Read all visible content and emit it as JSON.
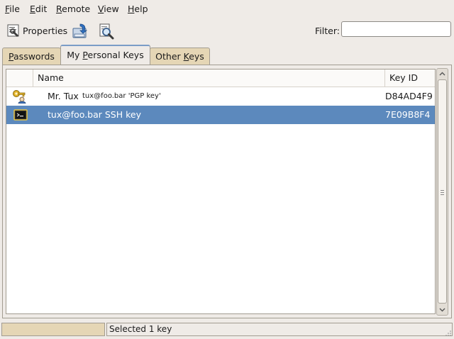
{
  "menubar": {
    "file": "File",
    "edit": "Edit",
    "remote": "Remote",
    "view": "View",
    "help": "Help"
  },
  "toolbar": {
    "properties_label": "Properties",
    "export_icon": "export-key-icon",
    "find_remote_icon": "find-remote-keys-icon",
    "filter_label": "Filter:",
    "filter_value": ""
  },
  "tabs": [
    {
      "label": "Passwords",
      "active": false
    },
    {
      "label": "My Personal Keys",
      "active": true
    },
    {
      "label": "Other Keys",
      "active": false
    }
  ],
  "table": {
    "columns": {
      "name": "Name",
      "key_id": "Key ID"
    },
    "rows": [
      {
        "name": "Mr. Tux",
        "detail": "tux@foo.bar  'PGP key'",
        "key_id": "D84AD4F9",
        "icon": "pgp-key-icon",
        "selected": false
      },
      {
        "name": "tux@foo.bar SSH key",
        "detail": "",
        "key_id": "7E09B8F4",
        "icon": "ssh-key-icon",
        "selected": true
      }
    ]
  },
  "status": {
    "text": "Selected 1 key"
  },
  "colors": {
    "selection": "#5c89bd",
    "tab_inactive": "#e5d6b5",
    "window_bg": "#efebe7"
  }
}
